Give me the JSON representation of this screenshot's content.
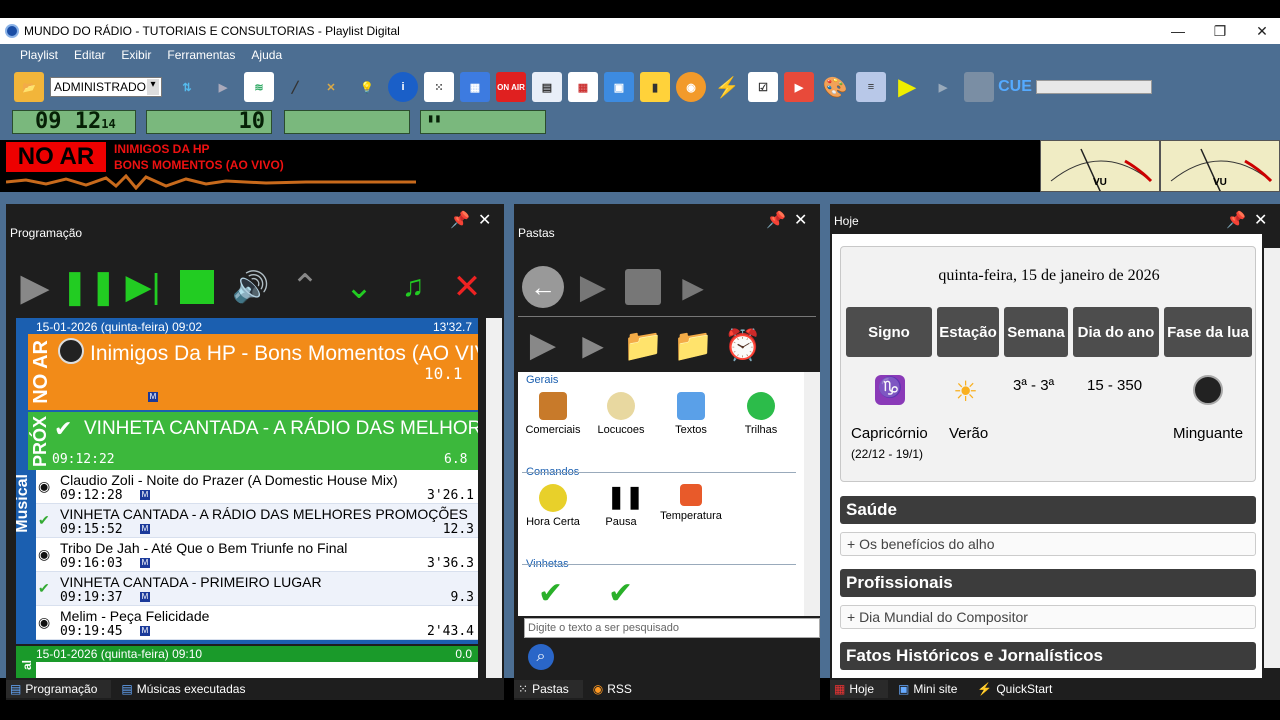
{
  "window": {
    "title": "MUNDO DO RÁDIO - TUTORIAIS E CONSULTORIAS - Playlist Digital"
  },
  "menu": [
    "Playlist",
    "Editar",
    "Exibir",
    "Ferramentas",
    "Ajuda"
  ],
  "toolbar": {
    "user_select": "ADMINISTRADOR",
    "onair_label": "ON AIR",
    "cue_label": "CUE"
  },
  "status": {
    "clock": "09 12",
    "clock_sec": "14",
    "counter": "10"
  },
  "onair": {
    "label": "NO AR",
    "line1": "INIMIGOS DA HP",
    "line2": "BONS MOMENTOS (AO VIVO)",
    "vu": "VU"
  },
  "programacao": {
    "title": "Programação",
    "block1": {
      "header": "15-01-2026 (quinta-feira) 09:02",
      "duration": "13'32.7"
    },
    "now": {
      "side": "NO AR",
      "title": "Inimigos Da HP - Bons Momentos (AO VIVO)",
      "time": "10.1"
    },
    "next": {
      "side": "PRÓX",
      "title": "VINHETA CANTADA - A RÁDIO DAS MELHORES PROMOÇÕES",
      "start": "09:12:22",
      "time": "6.8"
    },
    "side_label": "Musical",
    "items": [
      {
        "title": "Claudio Zoli - Noite do Prazer (A Domestic House Mix)",
        "start": "09:12:28",
        "dur": "3'26.1",
        "kind": "music"
      },
      {
        "title": "VINHETA CANTADA - A RÁDIO DAS MELHORES PROMOÇÕES",
        "start": "09:15:52",
        "dur": "12.3",
        "kind": "jingle"
      },
      {
        "title": "Tribo De Jah - Até Que o Bem Triunfe no Final",
        "start": "09:16:03",
        "dur": "3'36.3",
        "kind": "music"
      },
      {
        "title": "VINHETA CANTADA - PRIMEIRO LUGAR",
        "start": "09:19:37",
        "dur": "9.3",
        "kind": "jingle"
      },
      {
        "title": "Melim - Peça Felicidade",
        "start": "09:19:45",
        "dur": "2'43.4",
        "kind": "music"
      }
    ],
    "badge": "M",
    "block2": {
      "header": "15-01-2026 (quinta-feira) 09:10",
      "duration": "0.0",
      "side": "al"
    },
    "tabs": [
      "Programação",
      "Músicas executadas"
    ]
  },
  "pastas": {
    "title": "Pastas",
    "groups": [
      {
        "name": "Gerais",
        "items": [
          "Comerciais",
          "Locucoes",
          "Textos",
          "Trilhas"
        ]
      },
      {
        "name": "Comandos",
        "items": [
          "Hora Certa",
          "Pausa",
          "Temperatura"
        ]
      },
      {
        "name": "Vinhetas",
        "items": []
      }
    ],
    "search_placeholder": "Digite o texto a ser pesquisado",
    "tabs": [
      "Pastas",
      "RSS"
    ]
  },
  "hoje": {
    "title": "Hoje",
    "date": "quinta-feira, 15 de janeiro de 2026",
    "tiles": [
      "Signo",
      "Estação",
      "Semana",
      "Dia do ano",
      "Fase da lua"
    ],
    "signo": "Capricórnio",
    "signo_range": "(22/12 - 19/1)",
    "estacao": "Verão",
    "semana": "3ª - 3ª",
    "dia_ano": "15 - 350",
    "lua": "Minguante",
    "sections": [
      {
        "title": "Saúde",
        "item": "+ Os benefícios do alho"
      },
      {
        "title": "Profissionais",
        "item": "+ Dia Mundial do Compositor"
      },
      {
        "title": "Fatos Históricos e Jornalísticos",
        "item": ""
      }
    ],
    "tabs": [
      "Hoje",
      "Mini site",
      "QuickStart"
    ]
  }
}
